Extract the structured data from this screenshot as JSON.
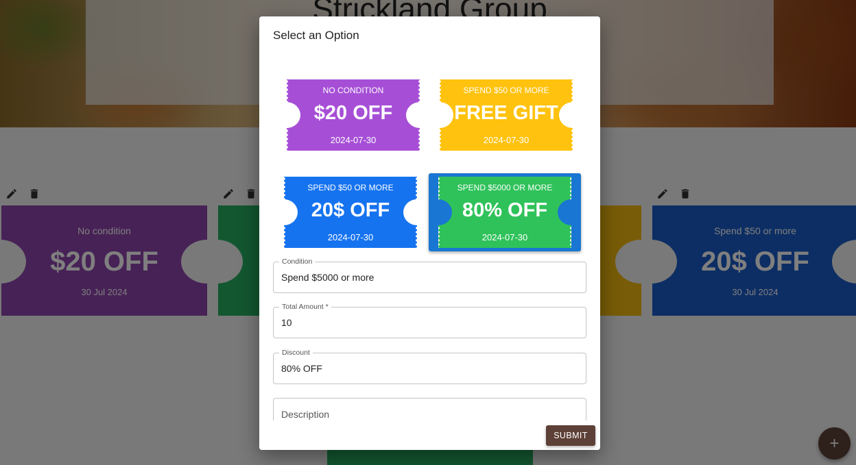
{
  "background": {
    "hero_title": "Strickland Group",
    "coupons": [
      {
        "condition": "No condition",
        "discount": "$20 OFF",
        "date": "30 Jul 2024",
        "color": "#8e44ad"
      },
      {
        "condition": "Spend $50 or more",
        "discount": "20$ OFF",
        "date": "30 Jul 2024",
        "color": "#1a5dc8"
      }
    ],
    "fab_label": "+"
  },
  "dialog": {
    "title": "Select an Option",
    "options": [
      {
        "condition": "NO CONDITION",
        "discount": "$20 OFF",
        "date": "2024-07-30",
        "color": "#a64fd6",
        "selected": false
      },
      {
        "condition": "SPEND $50 OR MORE",
        "discount": "FREE GIFT",
        "date": "2024-07-30",
        "color": "#ffc20e",
        "selected": false
      },
      {
        "condition": "SPEND $50 OR MORE",
        "discount": "20$ OFF",
        "date": "2024-07-30",
        "color": "#1673f0",
        "selected": false
      },
      {
        "condition": "SPEND $5000 OR MORE",
        "discount": "80% OFF",
        "date": "2024-07-30",
        "color": "#2fc25a",
        "selected": true
      }
    ],
    "fields": {
      "condition": {
        "label": "Condition",
        "value": "Spend $5000 or more"
      },
      "total_amount": {
        "label": "Total Amount *",
        "value": "10"
      },
      "discount": {
        "label": "Discount",
        "value": "80% OFF"
      },
      "description": {
        "placeholder": "Description"
      }
    },
    "submit_label": "SUBMIT"
  },
  "colors": {
    "primary_brown": "#5d4037",
    "selected_highlight": "#1976d2"
  }
}
